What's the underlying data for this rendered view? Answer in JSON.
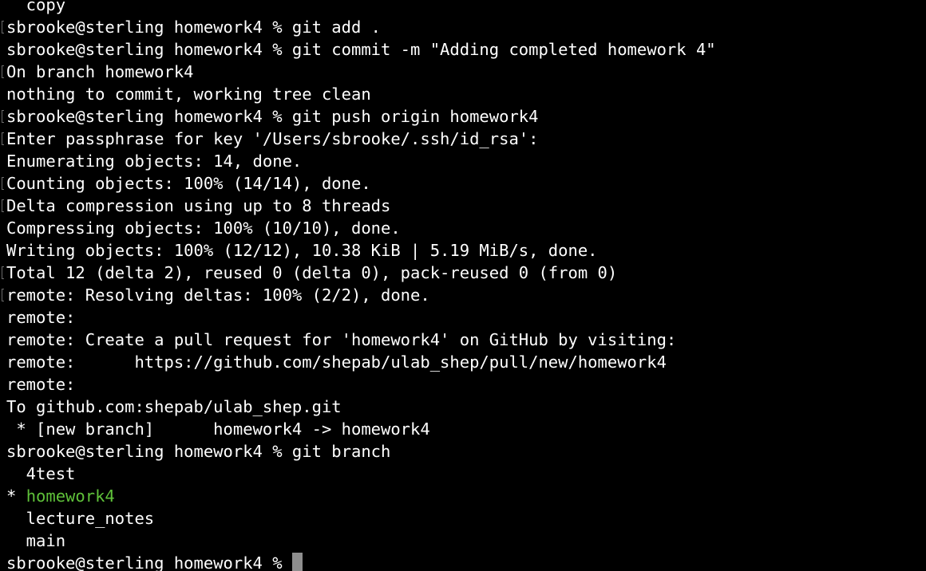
{
  "terminal": {
    "lines": [
      {
        "text": "  copy",
        "marker": false
      },
      {
        "text": "sbrooke@sterling homework4 % git add .",
        "marker": true
      },
      {
        "text": "sbrooke@sterling homework4 % git commit -m \"Adding completed homework 4\"",
        "marker": false
      },
      {
        "text": "On branch homework4",
        "marker": true
      },
      {
        "text": "nothing to commit, working tree clean",
        "marker": false
      },
      {
        "text": "sbrooke@sterling homework4 % git push origin homework4",
        "marker": true
      },
      {
        "text": "Enter passphrase for key '/Users/sbrooke/.ssh/id_rsa':",
        "marker": true
      },
      {
        "text": "Enumerating objects: 14, done.",
        "marker": false
      },
      {
        "text": "Counting objects: 100% (14/14), done.",
        "marker": true
      },
      {
        "text": "Delta compression using up to 8 threads",
        "marker": true
      },
      {
        "text": "Compressing objects: 100% (10/10), done.",
        "marker": false
      },
      {
        "text": "Writing objects: 100% (12/12), 10.38 KiB | 5.19 MiB/s, done.",
        "marker": false
      },
      {
        "text": "Total 12 (delta 2), reused 0 (delta 0), pack-reused 0 (from 0)",
        "marker": true
      },
      {
        "text": "remote: Resolving deltas: 100% (2/2), done.",
        "marker": true
      },
      {
        "text": "remote:",
        "marker": false
      },
      {
        "text": "remote: Create a pull request for 'homework4' on GitHub by visiting:",
        "marker": false
      },
      {
        "text": "remote:      https://github.com/shepab/ulab_shep/pull/new/homework4",
        "marker": false
      },
      {
        "text": "remote:",
        "marker": false
      },
      {
        "text": "To github.com:shepab/ulab_shep.git",
        "marker": false
      },
      {
        "text": " * [new branch]      homework4 -> homework4",
        "marker": false
      },
      {
        "text": "sbrooke@sterling homework4 % git branch",
        "marker": false
      },
      {
        "text": "  4test",
        "marker": false
      }
    ],
    "current_branch_prefix": "* ",
    "current_branch_name": "homework4",
    "after_lines": [
      {
        "text": "  lecture_notes"
      },
      {
        "text": "  main"
      }
    ],
    "prompt": "sbrooke@sterling homework4 % ",
    "colors": {
      "background": "#000000",
      "foreground": "#ffffff",
      "current_branch": "#5fc13a",
      "cursor": "#8e8e8e"
    }
  }
}
